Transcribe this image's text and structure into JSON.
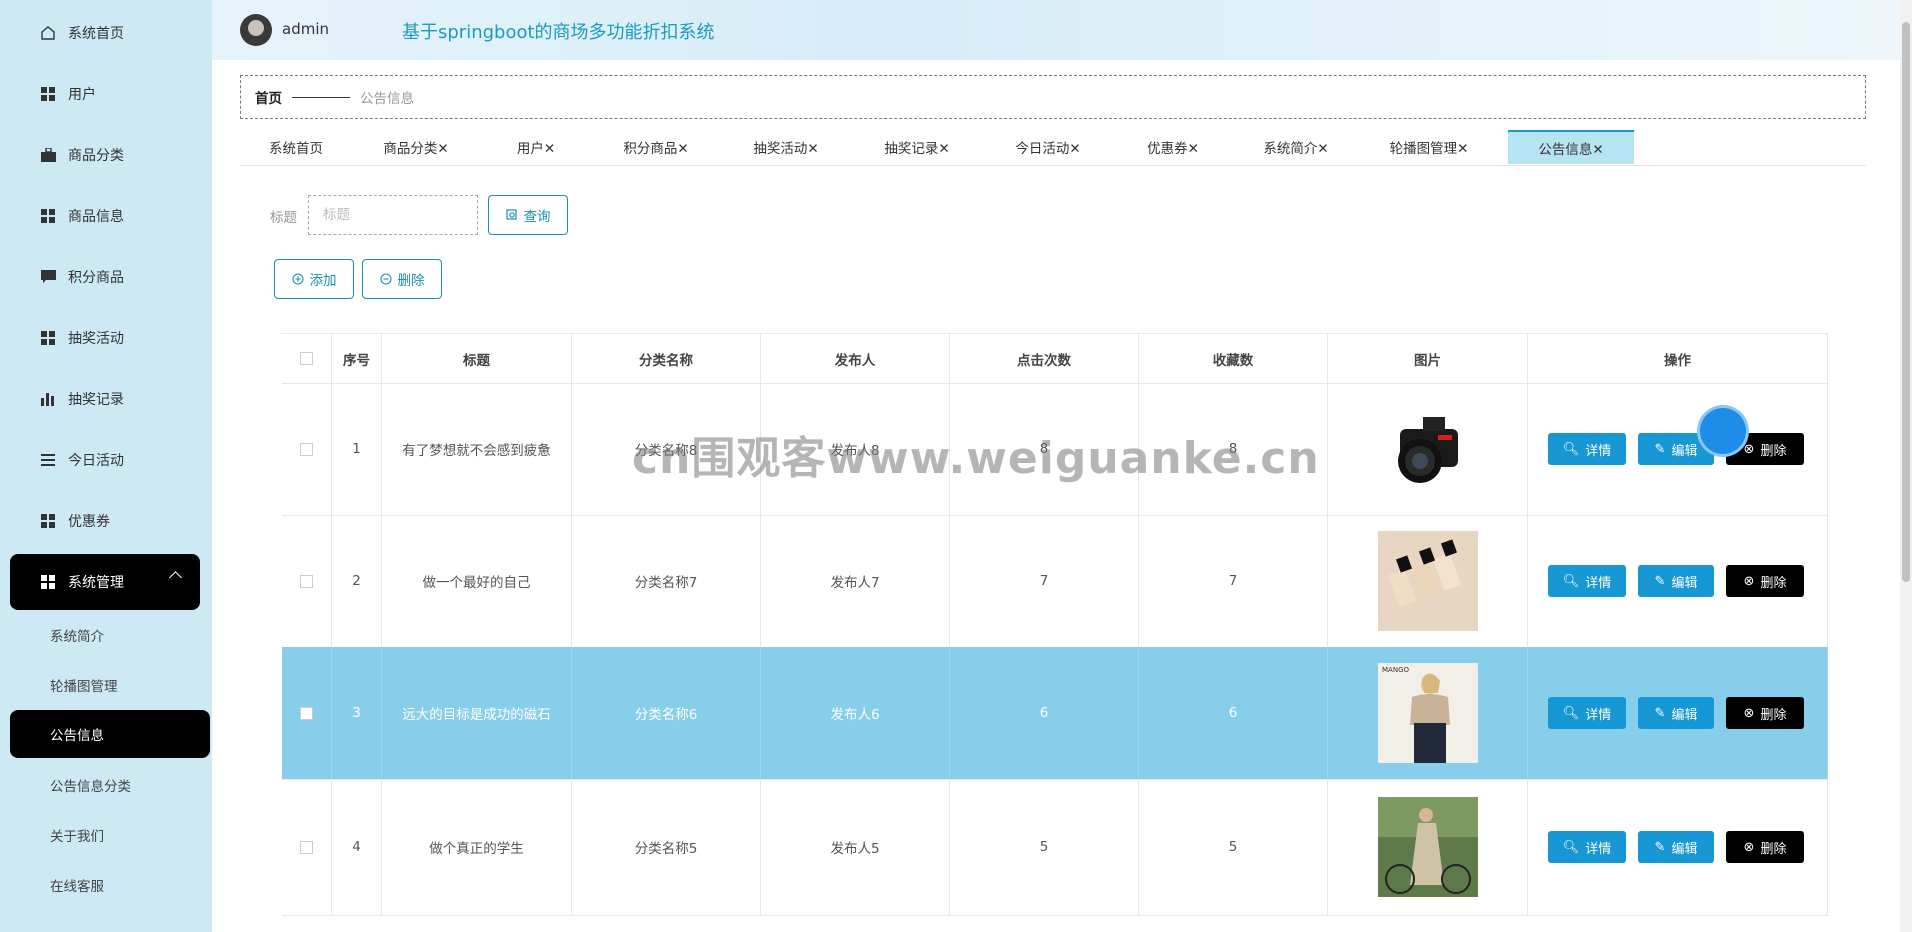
{
  "header": {
    "username": "admin",
    "system_title": "基于springboot的商场多功能折扣系统"
  },
  "sidebar": {
    "items": [
      {
        "label": "系统首页",
        "icon": "home-icon"
      },
      {
        "label": "用户",
        "icon": "grid-icon"
      },
      {
        "label": "商品分类",
        "icon": "briefcase-icon"
      },
      {
        "label": "商品信息",
        "icon": "grid-icon"
      },
      {
        "label": "积分商品",
        "icon": "chat-icon"
      },
      {
        "label": "抽奖活动",
        "icon": "grid-icon"
      },
      {
        "label": "抽奖记录",
        "icon": "bar-chart-icon"
      },
      {
        "label": "今日活动",
        "icon": "list-icon"
      },
      {
        "label": "优惠券",
        "icon": "grid-icon"
      },
      {
        "label": "系统管理",
        "icon": "grid-icon"
      }
    ],
    "sub_items": [
      "系统简介",
      "轮播图管理",
      "公告信息",
      "公告信息分类",
      "关于我们",
      "在线客服"
    ]
  },
  "breadcrumb": {
    "home": "首页",
    "current": "公告信息"
  },
  "tabs": [
    "系统首页",
    "商品分类✕",
    "用户✕",
    "积分商品✕",
    "抽奖活动✕",
    "抽奖记录✕",
    "今日活动✕",
    "优惠券✕",
    "系统简介✕",
    "轮播图管理✕",
    "公告信息✕"
  ],
  "search": {
    "label": "标题",
    "placeholder": "标题",
    "button": "查询"
  },
  "toolbar": {
    "add": "添加",
    "delete": "删除"
  },
  "table": {
    "headers": [
      "序号",
      "标题",
      "分类名称",
      "发布人",
      "点击次数",
      "收藏数",
      "图片",
      "操作"
    ],
    "rows": [
      {
        "index": "1",
        "title": "有了梦想就不会感到疲惫",
        "category": "分类名称8",
        "author": "发布人8",
        "clicks": "8",
        "favorites": "8",
        "image": "camera"
      },
      {
        "index": "2",
        "title": "做一个最好的自己",
        "category": "分类名称7",
        "author": "发布人7",
        "clicks": "7",
        "favorites": "7",
        "image": "cosmetics"
      },
      {
        "index": "3",
        "title": "远大的目标是成功的磁石",
        "category": "分类名称6",
        "author": "发布人6",
        "clicks": "6",
        "favorites": "6",
        "image": "fashion"
      },
      {
        "index": "4",
        "title": "做个真正的学生",
        "category": "分类名称5",
        "author": "发布人5",
        "clicks": "5",
        "favorites": "5",
        "image": "bicycle"
      }
    ],
    "actions": {
      "detail": "详情",
      "edit": "编辑",
      "delete": "删除"
    },
    "image_brand": "MANGO"
  },
  "watermark": "cn围观客www.weiguanke.cn",
  "colors": {
    "sidebar_bg": "#cde9f4",
    "accent": "#1a9bbf",
    "button_blue": "#1797d4",
    "selected_row": "#87ceeb"
  }
}
